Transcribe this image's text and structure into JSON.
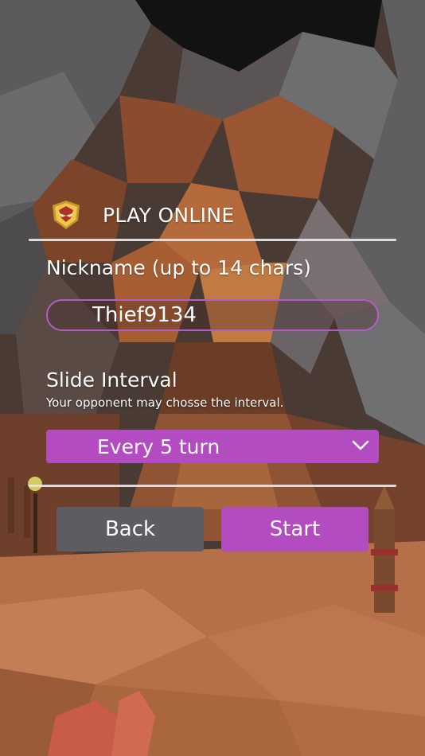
{
  "screen": {
    "title": "PLAY ONLINE",
    "title_icon": "shield-emblem-icon"
  },
  "nickname": {
    "label": "Nickname (up to 14 chars)",
    "value": "Thief9134"
  },
  "slide_interval": {
    "label": "Slide Interval",
    "hint": "Your opponent may chosse the interval.",
    "selected": "Every 5 turn",
    "chevron_icon": "chevron-down-icon"
  },
  "buttons": {
    "back_label": "Back",
    "start_label": "Start"
  },
  "colors": {
    "accent": "#b24cc0",
    "secondary_button": "#5d5d61",
    "text": "#ffffff"
  }
}
